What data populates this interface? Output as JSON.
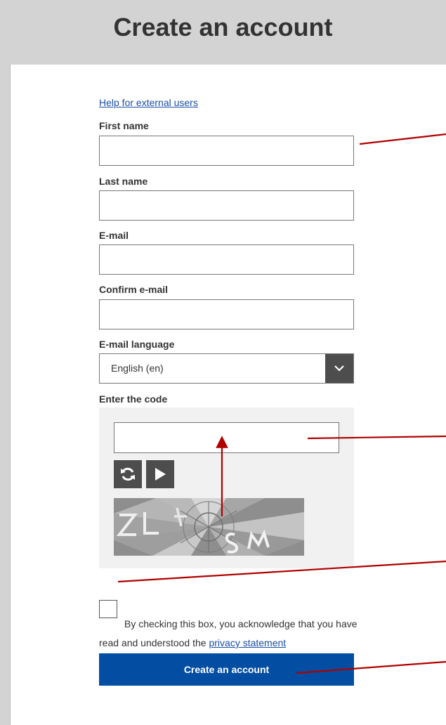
{
  "header": {
    "title": "Create an account"
  },
  "form": {
    "help_link": "Help for external users",
    "first_name": {
      "label": "First name",
      "value": ""
    },
    "last_name": {
      "label": "Last name",
      "value": ""
    },
    "email": {
      "label": "E-mail",
      "value": ""
    },
    "confirm_email": {
      "label": "Confirm e-mail",
      "value": ""
    },
    "email_language": {
      "label": "E-mail language",
      "selected": "English (en)"
    },
    "captcha": {
      "label": "Enter the code",
      "value": "",
      "refresh_icon": "refresh-icon",
      "play_icon": "play-icon"
    },
    "consent": {
      "text": "By checking this box, you acknowledge that you have read and understood the",
      "link": "privacy statement",
      "checked": false
    },
    "submit_label": "Create an account"
  },
  "colors": {
    "background": "#d3d3d3",
    "primary_button": "#034ea2",
    "link": "#1a4fa3",
    "annotation": "#b00000",
    "captcha_panel": "#f1f1f1",
    "icon_button": "#4d4d4d"
  }
}
